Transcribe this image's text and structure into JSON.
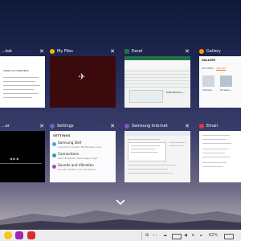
{
  "recents": {
    "row1": [
      {
        "title": "...bat",
        "icon_color": "#e53935",
        "close": "✕",
        "doc_heading": "TABLE OF CONTENTS"
      },
      {
        "title": "My Files",
        "icon_color": "#ffb300",
        "close": "✕"
      },
      {
        "title": "Excel",
        "icon_color": "#1e7145",
        "close": "✕",
        "cell_label": "ELECTRICAL L..."
      },
      {
        "title": "Gallery",
        "icon_color": "#ff9800",
        "close": "✕",
        "header": "GALLERY",
        "tab_pictures": "PICTURES",
        "tab_albums": "ALBUMS",
        "album_1": "Camera",
        "album_2": "Screens..."
      }
    ],
    "row2": [
      {
        "title": "...er",
        "icon_color": "#1e88e5",
        "close": "✕"
      },
      {
        "title": "Settings",
        "icon_color": "#5c6bc0",
        "close": "✕",
        "header": "SETTINGS",
        "items": [
          {
            "label": "Samsung DeX",
            "sub": "Connect to monitor, Multiwindow, Sync"
          },
          {
            "label": "Connections",
            "sub": "Wi-Fi, Bluetooth, Data usage, Flight"
          },
          {
            "label": "Sounds and Vibration",
            "sub": "Sounds, Vibration, Do not disturb"
          }
        ]
      },
      {
        "title": "Samsung Internet",
        "icon_color": "#7e57c2",
        "close": "✕"
      },
      {
        "title": "Email",
        "icon_color": "#e53935",
        "close": "✕"
      }
    ]
  },
  "nav": {
    "show_apps_icon": "chevron-up",
    "glyph": "⌄"
  },
  "taskbar": {
    "apps": [
      {
        "name": "Samsung Notes",
        "color": "#f5c518"
      },
      {
        "name": "Galaxy Store",
        "color": "#9c27b0"
      },
      {
        "name": "Pdf Drive",
        "color": "#d32f2f"
      }
    ],
    "tray": {
      "grid": "⊞",
      "cloud": "☁",
      "battery_pct": "62%",
      "arrows": "‹ ›",
      "volume": "◀",
      "signal": "▴",
      "bluetooth": "ʙ"
    }
  }
}
